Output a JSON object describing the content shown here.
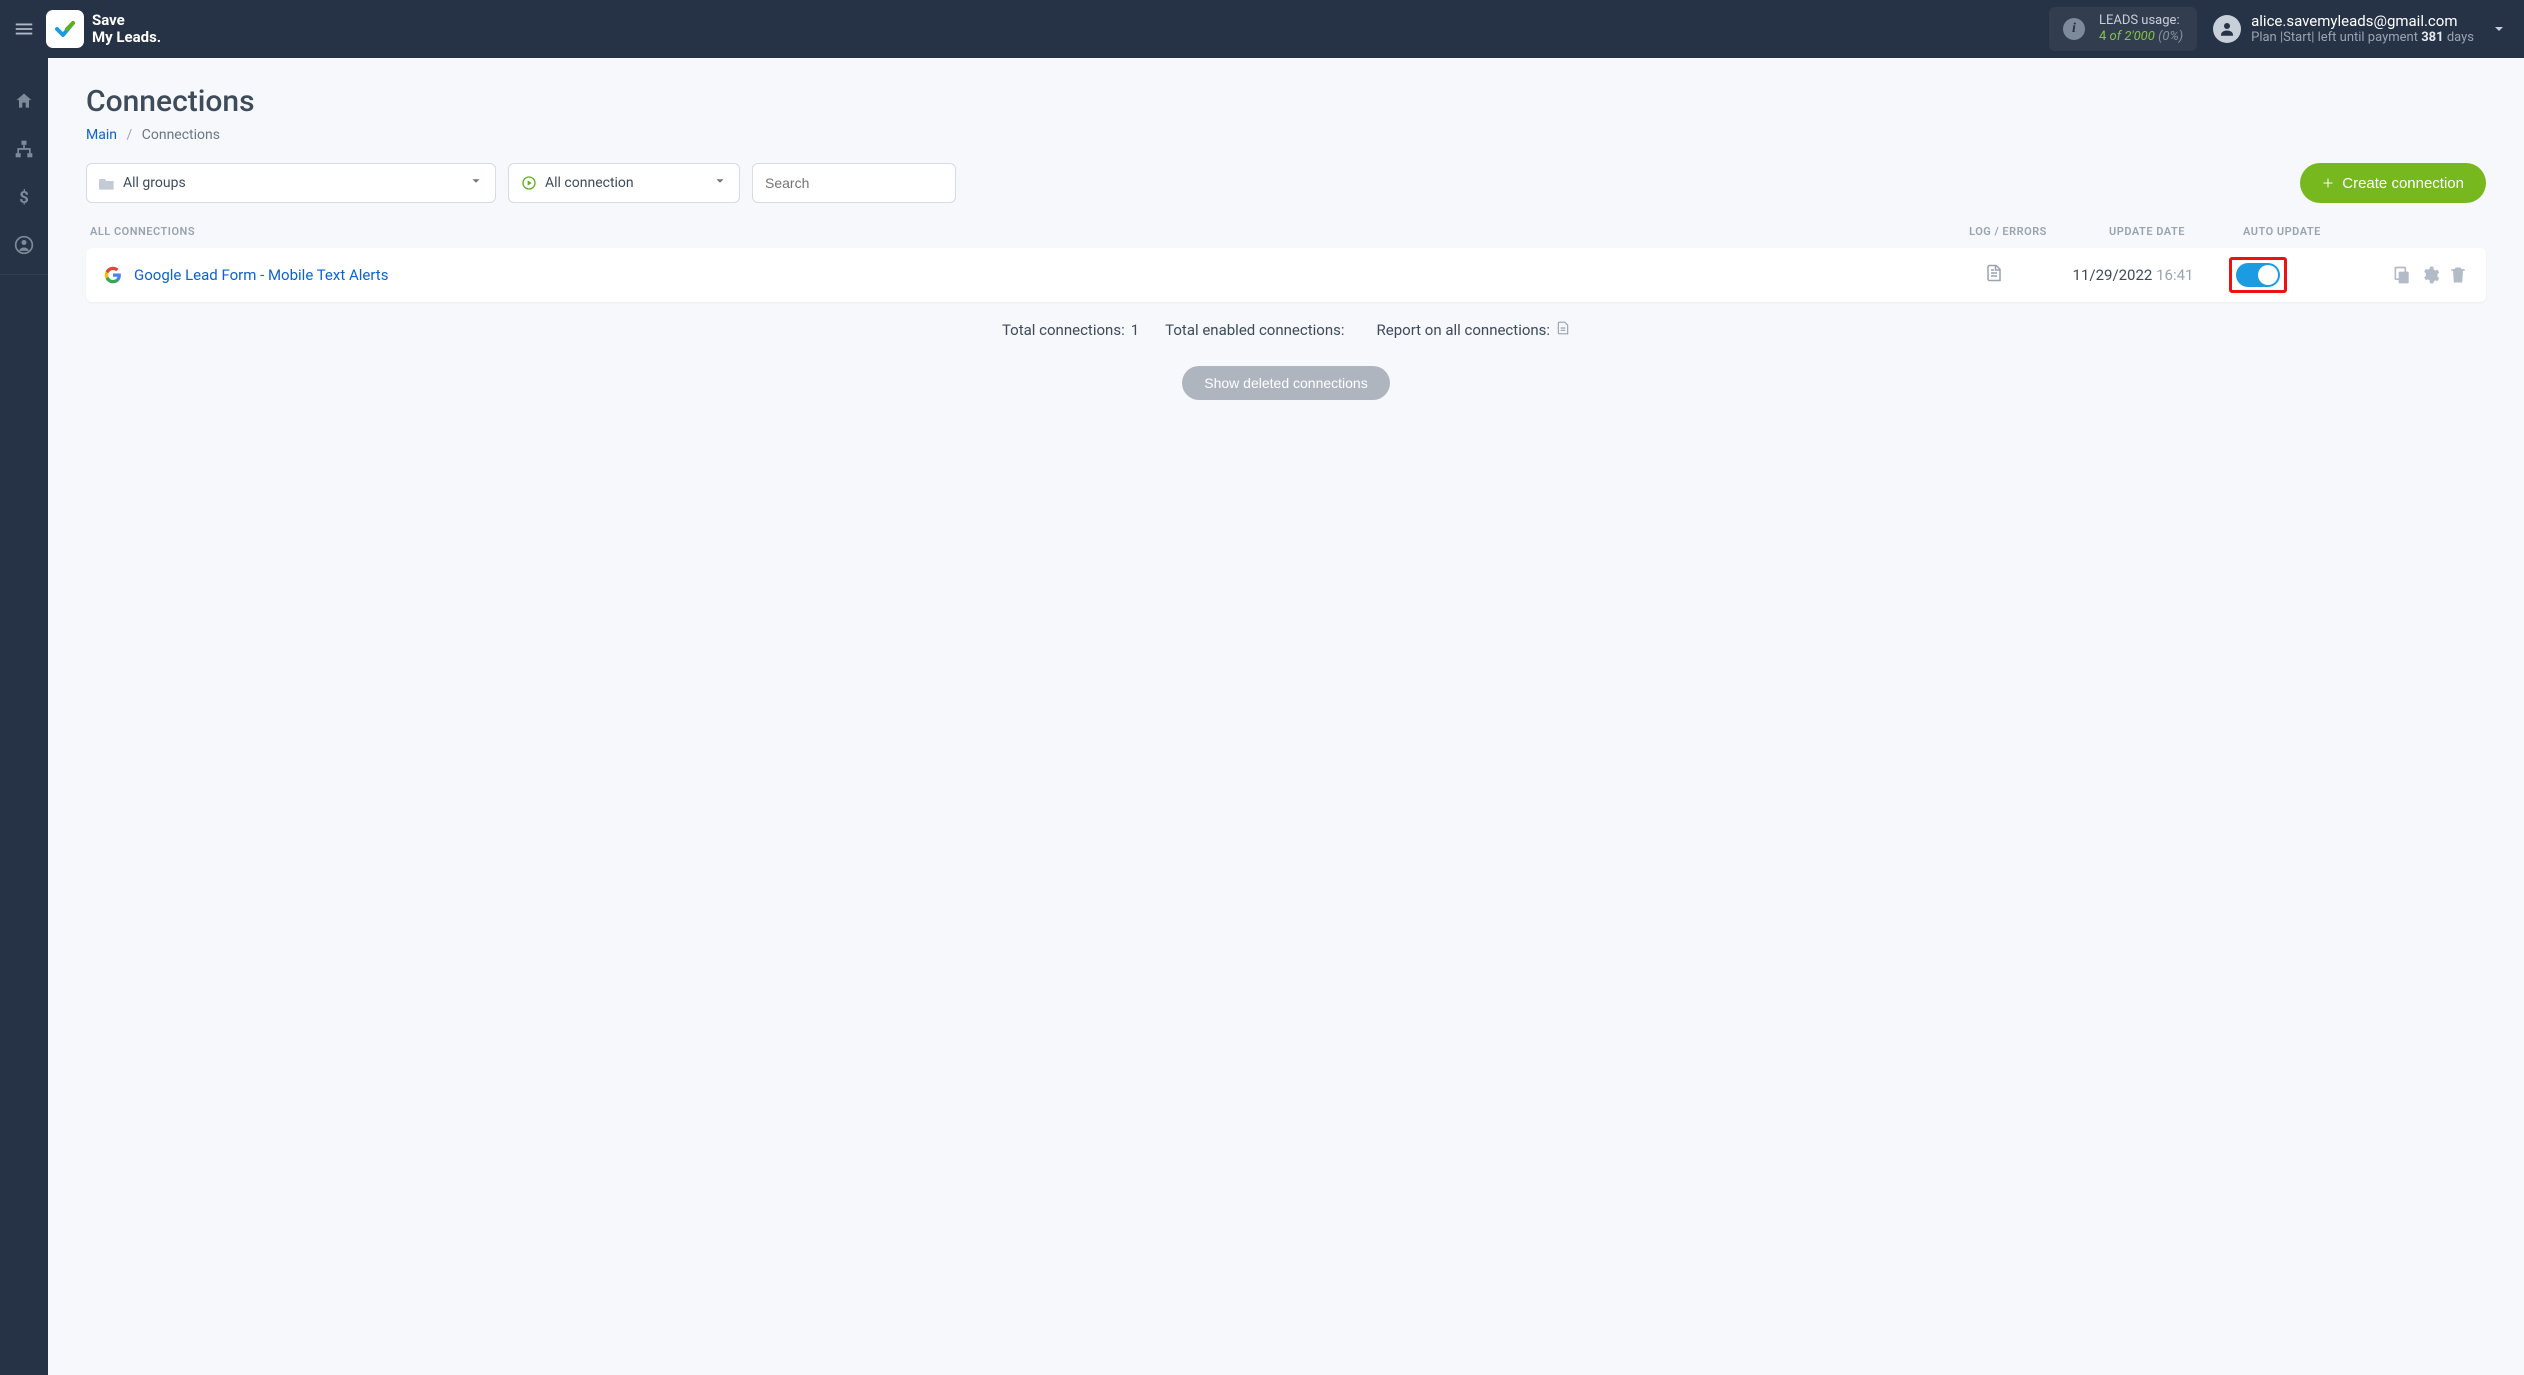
{
  "brand": {
    "line1": "Save",
    "line2": "My Leads."
  },
  "usage": {
    "title": "LEADS usage:",
    "value": "4",
    "of_word": "of",
    "limit": "2'000",
    "percent": "(0%)"
  },
  "account": {
    "email": "alice.savemyleads@gmail.com",
    "plan_label": "Plan",
    "plan_name": "Start",
    "left_prefix": "left until payment",
    "days_value": "381",
    "days_word": "days"
  },
  "page": {
    "title": "Connections",
    "breadcrumb_main": "Main",
    "breadcrumb_current": "Connections"
  },
  "filters": {
    "groups_label": "All groups",
    "status_label": "All connection",
    "search_placeholder": "Search"
  },
  "actions": {
    "create": "Create connection",
    "show_deleted": "Show deleted connections"
  },
  "table": {
    "headers": {
      "all": "ALL CONNECTIONS",
      "log": "LOG / ERRORS",
      "date": "UPDATE DATE",
      "auto": "AUTO UPDATE"
    },
    "rows": [
      {
        "name": "Google Lead Form - Mobile Text Alerts",
        "date": "11/29/2022",
        "time": "16:41",
        "auto_update": true
      }
    ]
  },
  "summary": {
    "total_label": "Total connections:",
    "total_value": "1",
    "enabled_label": "Total enabled connections:",
    "enabled_value": "",
    "report_label": "Report on all connections:"
  }
}
